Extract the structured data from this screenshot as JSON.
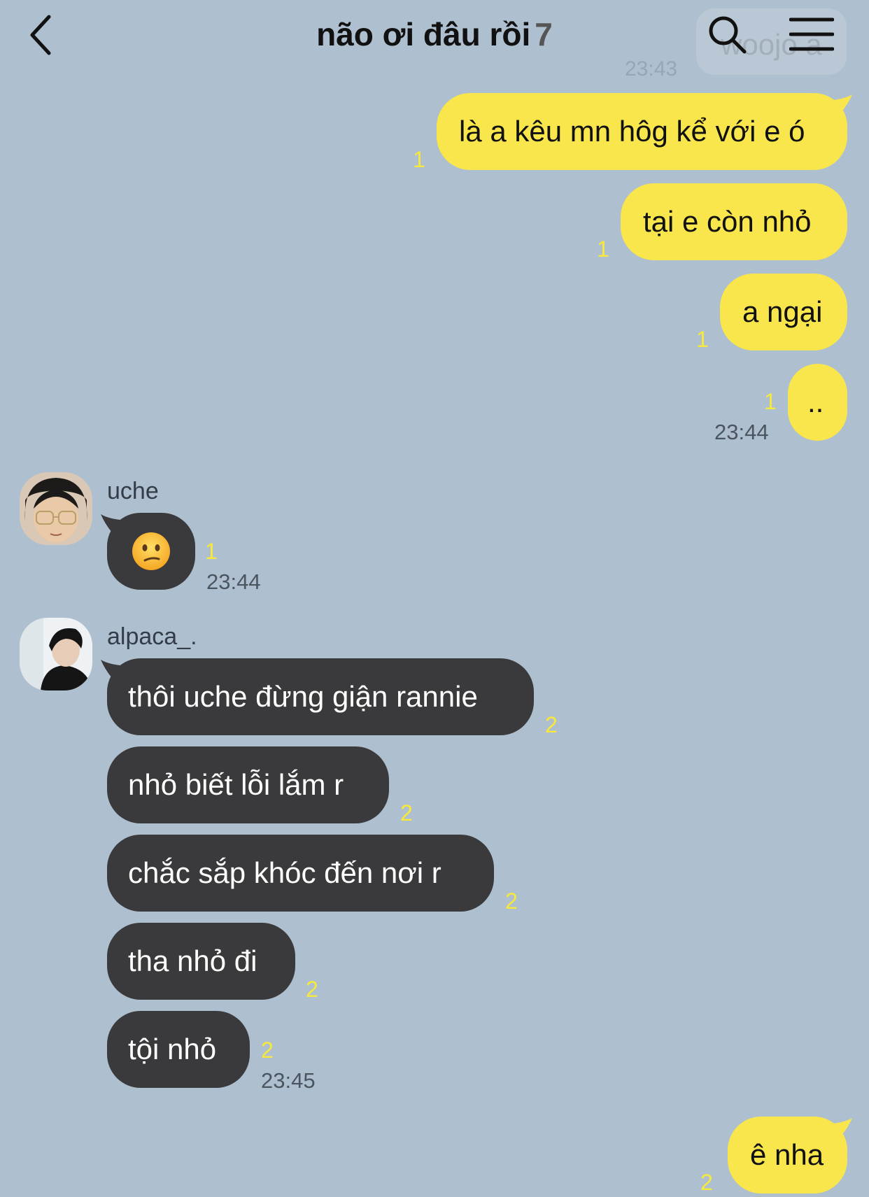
{
  "header": {
    "title": "não ơi đâu rồi",
    "member_count": "7",
    "faded_preview_text": "woojo a",
    "faded_preview_time": "23:43"
  },
  "messages": {
    "m1": {
      "text": "là a kêu mn hôg kể với e ó",
      "unread": "1"
    },
    "m2": {
      "text": "tại e còn nhỏ",
      "unread": "1"
    },
    "m3": {
      "text": "a ngại",
      "unread": "1"
    },
    "m4": {
      "text": "..",
      "unread": "1",
      "time": "23:44"
    },
    "uche": {
      "sender": "uche",
      "emoji": "😕",
      "unread": "1",
      "time": "23:44"
    },
    "alpaca": {
      "sender": "alpaca_.",
      "a1": {
        "text": "thôi uche đừng giận rannie",
        "unread": "2"
      },
      "a2": {
        "text": "nhỏ biết lỗi lắm r",
        "unread": "2"
      },
      "a3": {
        "text": "chắc sắp khóc đến nơi r",
        "unread": "2"
      },
      "a4": {
        "text": "tha nhỏ đi",
        "unread": "2"
      },
      "a5": {
        "text": "tội nhỏ",
        "unread": "2",
        "time": "23:45"
      }
    },
    "m5": {
      "text": "ê nha",
      "unread": "2"
    }
  },
  "colors": {
    "background": "#aebfcf",
    "my_bubble": "#f8e64c",
    "their_bubble": "#3a3a3c",
    "unread_count": "#f6e93b"
  }
}
